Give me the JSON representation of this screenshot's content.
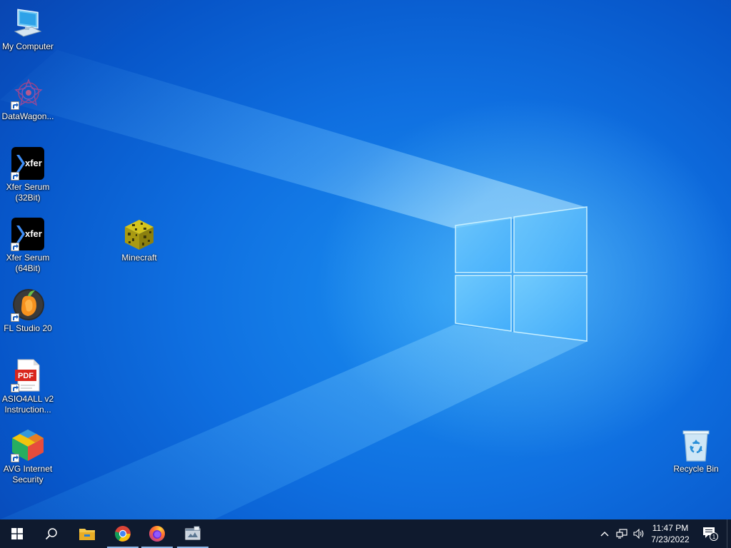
{
  "desktop": {
    "icons": [
      {
        "label": "My Computer",
        "icon": "computer-icon"
      },
      {
        "label": "DataWagon...",
        "icon": "datawagon-icon"
      },
      {
        "label": "Xfer Serum\n(32Bit)",
        "label_l1": "Xfer Serum",
        "label_l2": "(32Bit)",
        "icon": "xfer-serum-icon",
        "brand_text": "xfer"
      },
      {
        "label_l1": "Xfer Serum",
        "label_l2": "(64Bit)",
        "icon": "xfer-serum-icon",
        "brand_text": "xfer"
      },
      {
        "label": "FL Studio 20",
        "icon": "fl-studio-icon"
      },
      {
        "label_l1": "ASIO4ALL v2",
        "label_l2": "Instruction...",
        "icon": "pdf-icon",
        "badge": "PDF"
      },
      {
        "label_l1": "AVG Internet",
        "label_l2": "Security",
        "icon": "avg-icon"
      },
      {
        "label": "Minecraft",
        "icon": "minecraft-icon"
      },
      {
        "label": "Recycle Bin",
        "icon": "recycle-bin-icon"
      }
    ]
  },
  "taskbar": {
    "buttons": [
      {
        "name": "start-button",
        "icon": "windows-logo-icon"
      },
      {
        "name": "search-button",
        "icon": "search-icon"
      },
      {
        "name": "file-explorer-button",
        "icon": "folder-icon"
      },
      {
        "name": "chrome-button",
        "icon": "chrome-icon"
      },
      {
        "name": "firefox-button",
        "icon": "firefox-icon"
      },
      {
        "name": "app-button",
        "icon": "app-window-icon"
      }
    ],
    "tray": {
      "icons": [
        "chevron-up-icon",
        "network-icon",
        "volume-icon"
      ],
      "time": "11:47 PM",
      "date": "7/23/2022",
      "notification_count": "1"
    }
  },
  "colors": {
    "taskbar": "#0f1a2e",
    "wallpaper_blue": "#0f6fe0",
    "logo_glow": "#9fe0ff"
  }
}
